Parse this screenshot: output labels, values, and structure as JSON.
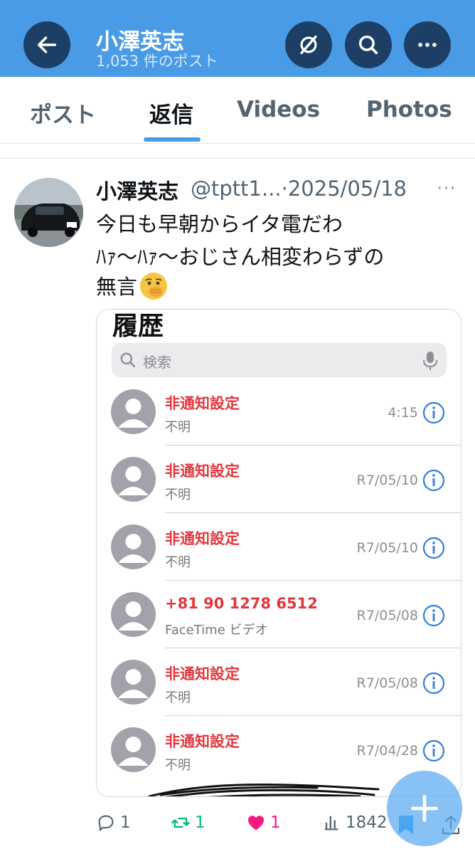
{
  "header": {
    "title": "小澤英志",
    "subtitle": "1,053 件のポスト",
    "back_icon": "arrow-left-icon",
    "grok_icon": "grok-icon",
    "search_icon": "search-icon",
    "more_icon": "more-horizontal-icon",
    "background_color": "#4a9be6"
  },
  "tabs": [
    {
      "label": "ポスト",
      "active": false
    },
    {
      "label": "返信",
      "active": true
    },
    {
      "label": "Videos",
      "active": false
    },
    {
      "label": "Photos",
      "active": false
    }
  ],
  "tweet": {
    "author_name": "小澤英志",
    "handle": "@tptt1...",
    "separator": "·",
    "date": "2025/05/18",
    "more": "···",
    "text_lines": [
      "今日も早朝からイタ電だわ",
      "ﾊｧ〜ﾊｧ〜おじさん相変わらずの",
      "無言"
    ],
    "emoji": "face-with-hand-over-mouth-emoji"
  },
  "media": {
    "heading": "履歴",
    "search_placeholder": "検索",
    "calls": [
      {
        "name": "非通知設定",
        "type": "不明",
        "time": "4:15"
      },
      {
        "name": "非通知設定",
        "type": "不明",
        "time": "R7/05/10"
      },
      {
        "name": "非通知設定",
        "type": "不明",
        "time": "R7/05/10"
      },
      {
        "name": "+81 90 1278 6512",
        "type": "FaceTime ビデオ",
        "time": "R7/05/08"
      },
      {
        "name": "非通知設定",
        "type": "不明",
        "time": "R7/05/08"
      },
      {
        "name": "非通知設定",
        "type": "不明",
        "time": "R7/04/28"
      }
    ],
    "missed_color": "#e0383e"
  },
  "actions": {
    "replies": "1",
    "retweets": "1",
    "likes": "1",
    "views": "1842",
    "retweet_color": "#00ba7c",
    "like_color": "#f91880"
  },
  "fab": {
    "icon": "plus-icon"
  }
}
